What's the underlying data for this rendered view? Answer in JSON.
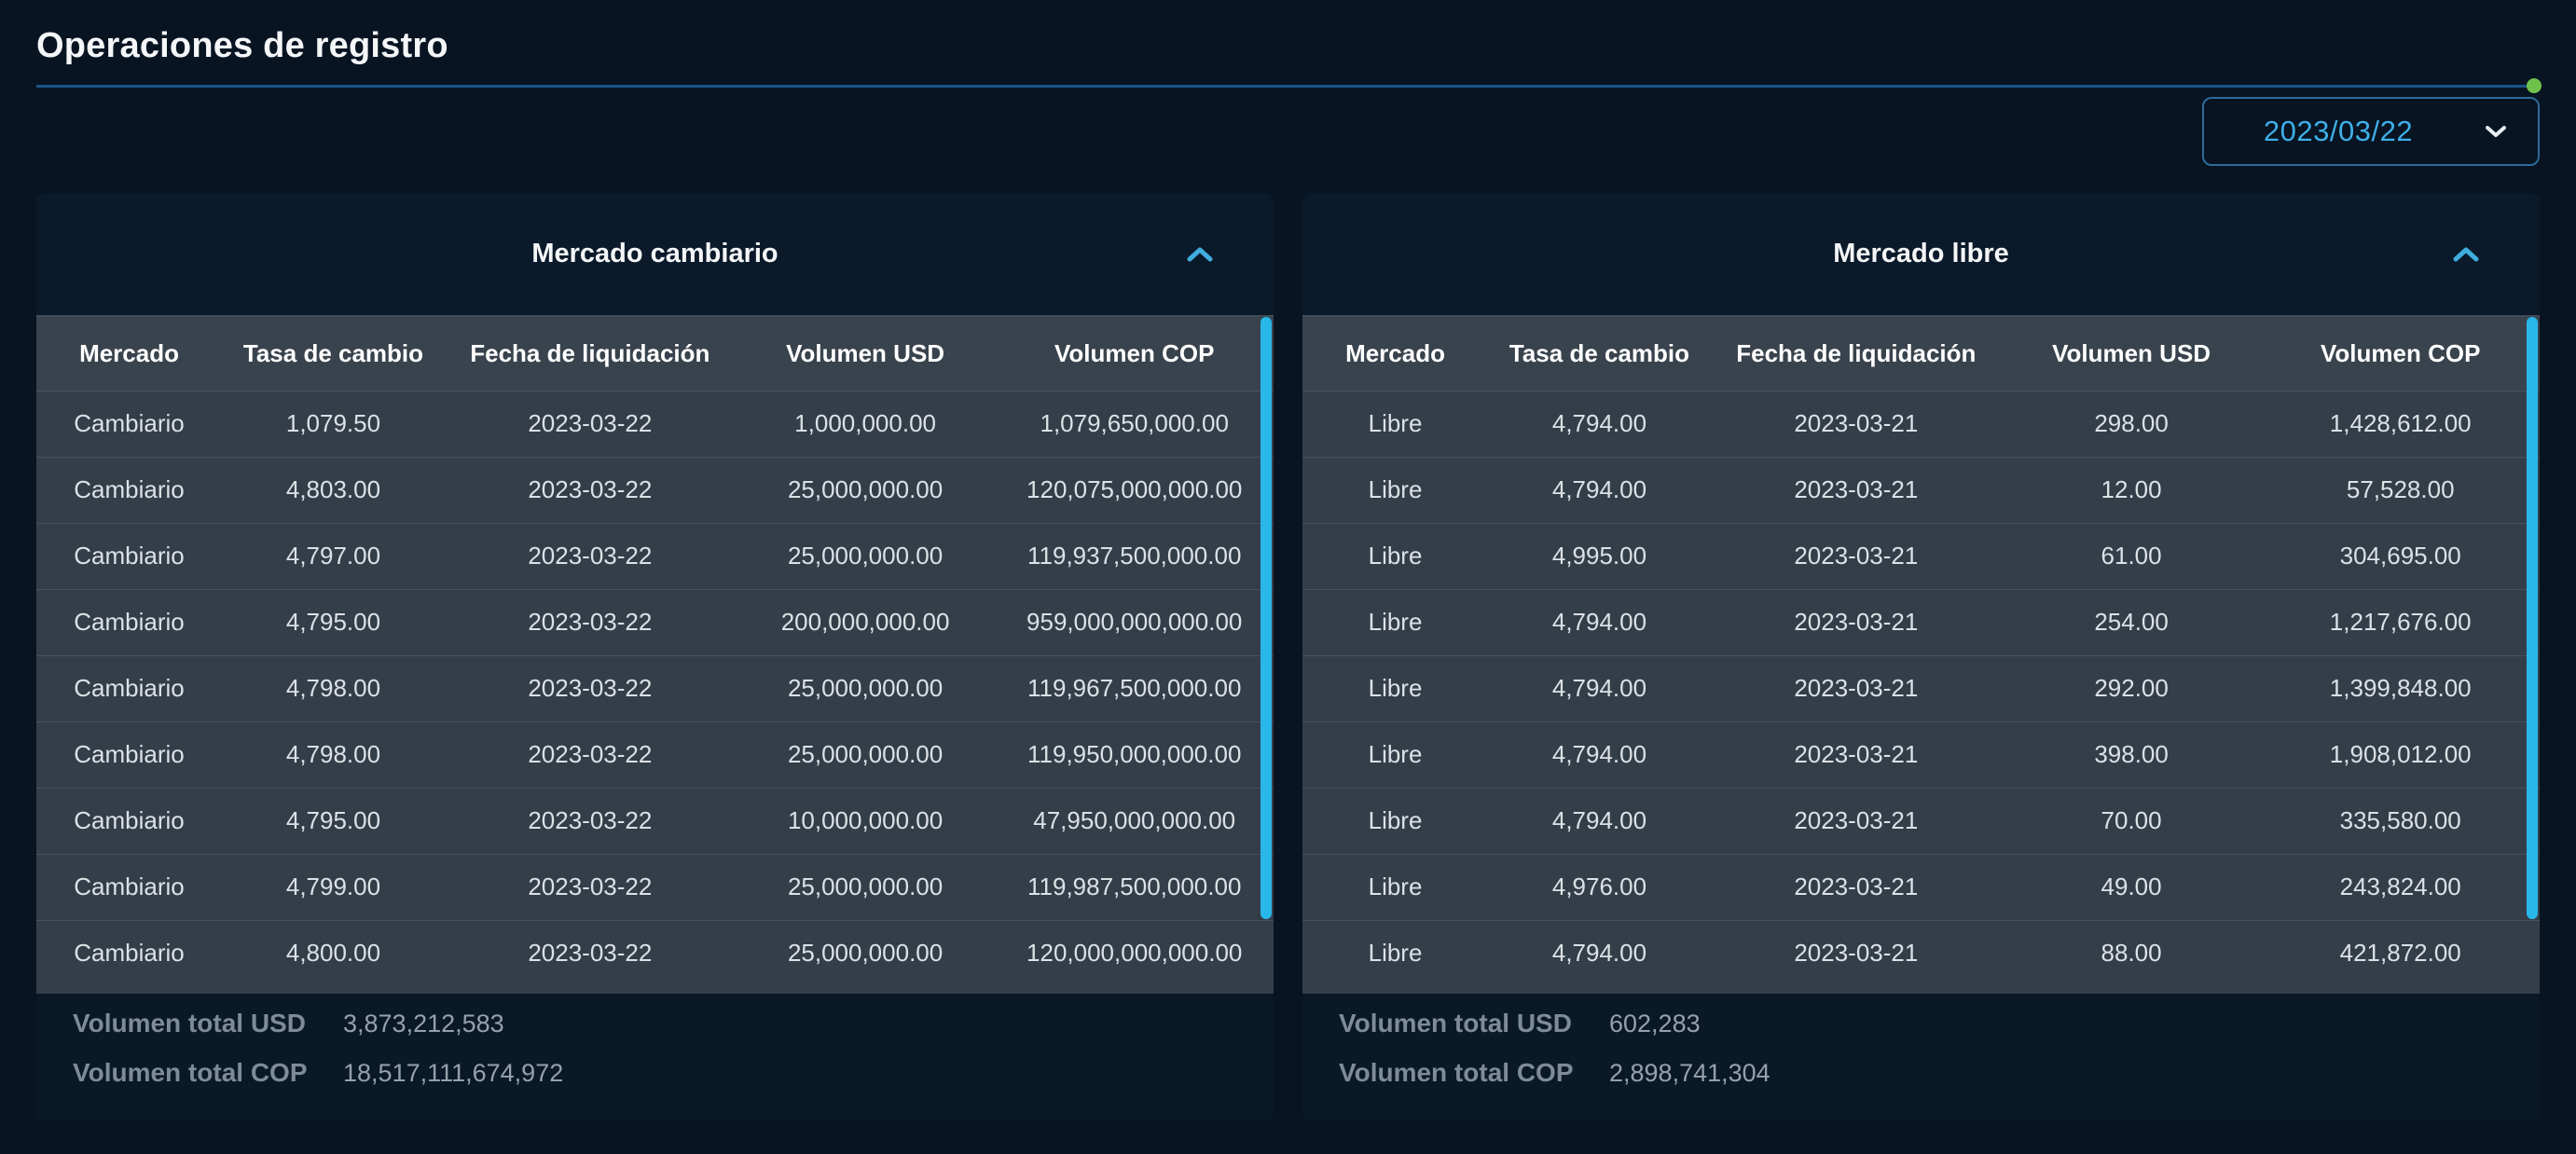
{
  "page": {
    "title": "Operaciones de registro"
  },
  "date_picker": {
    "value": "2023/03/22"
  },
  "columns": [
    "Mercado",
    "Tasa de cambio",
    "Fecha de liquidación",
    "Volumen USD",
    "Volumen COP"
  ],
  "cards": [
    {
      "title": "Mercado cambiario",
      "rows": [
        [
          "Cambiario",
          "1,079.50",
          "2023-03-22",
          "1,000,000.00",
          "1,079,650,000.00"
        ],
        [
          "Cambiario",
          "4,803.00",
          "2023-03-22",
          "25,000,000.00",
          "120,075,000,000.00"
        ],
        [
          "Cambiario",
          "4,797.00",
          "2023-03-22",
          "25,000,000.00",
          "119,937,500,000.00"
        ],
        [
          "Cambiario",
          "4,795.00",
          "2023-03-22",
          "200,000,000.00",
          "959,000,000,000.00"
        ],
        [
          "Cambiario",
          "4,798.00",
          "2023-03-22",
          "25,000,000.00",
          "119,967,500,000.00"
        ],
        [
          "Cambiario",
          "4,798.00",
          "2023-03-22",
          "25,000,000.00",
          "119,950,000,000.00"
        ],
        [
          "Cambiario",
          "4,795.00",
          "2023-03-22",
          "10,000,000.00",
          "47,950,000,000.00"
        ],
        [
          "Cambiario",
          "4,799.00",
          "2023-03-22",
          "25,000,000.00",
          "119,987,500,000.00"
        ],
        [
          "Cambiario",
          "4,800.00",
          "2023-03-22",
          "25,000,000.00",
          "120,000,000,000.00"
        ]
      ],
      "totals": {
        "usd_label": "Volumen total USD",
        "usd_value": "3,873,212,583",
        "cop_label": "Volumen total COP",
        "cop_value": "18,517,111,674,972"
      }
    },
    {
      "title": "Mercado libre",
      "rows": [
        [
          "Libre",
          "4,794.00",
          "2023-03-21",
          "298.00",
          "1,428,612.00"
        ],
        [
          "Libre",
          "4,794.00",
          "2023-03-21",
          "12.00",
          "57,528.00"
        ],
        [
          "Libre",
          "4,995.00",
          "2023-03-21",
          "61.00",
          "304,695.00"
        ],
        [
          "Libre",
          "4,794.00",
          "2023-03-21",
          "254.00",
          "1,217,676.00"
        ],
        [
          "Libre",
          "4,794.00",
          "2023-03-21",
          "292.00",
          "1,399,848.00"
        ],
        [
          "Libre",
          "4,794.00",
          "2023-03-21",
          "398.00",
          "1,908,012.00"
        ],
        [
          "Libre",
          "4,794.00",
          "2023-03-21",
          "70.00",
          "335,580.00"
        ],
        [
          "Libre",
          "4,976.00",
          "2023-03-21",
          "49.00",
          "243,824.00"
        ],
        [
          "Libre",
          "4,794.00",
          "2023-03-21",
          "88.00",
          "421,872.00"
        ]
      ],
      "totals": {
        "usd_label": "Volumen total USD",
        "usd_value": "602,283",
        "cop_label": "Volumen total COP",
        "cop_value": "2,898,741,304"
      }
    }
  ],
  "colors": {
    "page_bg": "#081422",
    "card_header_bg": "#0b1a2a",
    "row_bg": "#343e49",
    "header_row_bg": "#39434d",
    "footer_bg": "#0a1928",
    "accent_blue": "#3eafe8",
    "scrollbar_blue": "#29b7ea",
    "rule_blue": "#1c5383",
    "status_green": "#6ec24c"
  }
}
